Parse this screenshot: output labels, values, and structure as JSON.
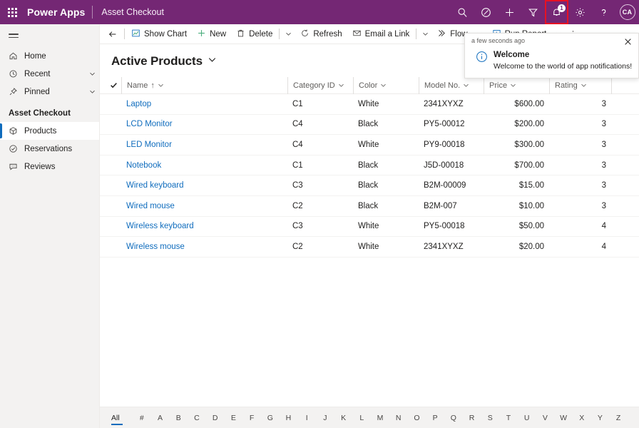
{
  "topbar": {
    "waffle_label": "app-launcher",
    "brand": "Power Apps",
    "app_name": "Asset Checkout",
    "icons": [
      {
        "name": "search-icon",
        "label": "Search"
      },
      {
        "name": "diagnostics-icon",
        "label": "Diagnostics"
      },
      {
        "name": "plus-icon",
        "label": "Quick create"
      },
      {
        "name": "filter-icon",
        "label": "Filter"
      },
      {
        "name": "bell-icon",
        "label": "Notifications"
      },
      {
        "name": "gear-icon",
        "label": "Settings"
      },
      {
        "name": "help-icon",
        "label": "Help"
      }
    ],
    "notification_badge": "1",
    "avatar_initials": "CA",
    "accent_color": "#742774",
    "highlight_color": "#e81123"
  },
  "sidebar": {
    "hamburger_label": "Site map",
    "items": [
      {
        "label": "Home",
        "icon": "home-icon",
        "chevron": false
      },
      {
        "label": "Recent",
        "icon": "clock-icon",
        "chevron": true
      },
      {
        "label": "Pinned",
        "icon": "pin-icon",
        "chevron": true
      }
    ],
    "group_title": "Asset Checkout",
    "group_items": [
      {
        "label": "Products",
        "icon": "box-icon",
        "selected": true
      },
      {
        "label": "Reservations",
        "icon": "check-circle-icon",
        "selected": false
      },
      {
        "label": "Reviews",
        "icon": "comment-icon",
        "selected": false
      }
    ]
  },
  "commandbar": {
    "back_label": "Back",
    "commands": [
      {
        "label": "Show Chart",
        "icon": "chart-icon",
        "caret": false
      },
      {
        "label": "New",
        "icon": "plus-icon",
        "caret": false
      },
      {
        "label": "Delete",
        "icon": "trash-icon",
        "caret": true
      },
      {
        "label": "Refresh",
        "icon": "refresh-icon",
        "caret": false
      },
      {
        "label": "Email a Link",
        "icon": "email-link-icon",
        "caret": true
      },
      {
        "label": "Flow",
        "icon": "flow-icon",
        "caret": true
      },
      {
        "label": "Run Report",
        "icon": "report-icon",
        "caret": true
      }
    ]
  },
  "view": {
    "title": "Active Products",
    "chevron": "chevron-down-icon"
  },
  "grid": {
    "columns": [
      {
        "label": "Name",
        "sort": "ascending",
        "sort_glyph": "↑"
      },
      {
        "label": "Category ID",
        "sort": null
      },
      {
        "label": "Color",
        "sort": null
      },
      {
        "label": "Model No.",
        "sort": null
      },
      {
        "label": "Price",
        "sort": null
      },
      {
        "label": "Rating",
        "sort": null
      }
    ],
    "rows": [
      {
        "name": "Laptop",
        "category": "C1",
        "color": "White",
        "model": "2341XYXZ",
        "price": "$600.00",
        "rating": "3"
      },
      {
        "name": "LCD Monitor",
        "category": "C4",
        "color": "Black",
        "model": "PY5-00012",
        "price": "$200.00",
        "rating": "3"
      },
      {
        "name": "LED Monitor",
        "category": "C4",
        "color": "White",
        "model": "PY9-00018",
        "price": "$300.00",
        "rating": "3"
      },
      {
        "name": "Notebook",
        "category": "C1",
        "color": "Black",
        "model": "J5D-00018",
        "price": "$700.00",
        "rating": "3"
      },
      {
        "name": "Wired keyboard",
        "category": "C3",
        "color": "Black",
        "model": "B2M-00009",
        "price": "$15.00",
        "rating": "3"
      },
      {
        "name": "Wired mouse",
        "category": "C2",
        "color": "Black",
        "model": "B2M-007",
        "price": "$10.00",
        "rating": "3"
      },
      {
        "name": "Wireless keyboard",
        "category": "C3",
        "color": "White",
        "model": "PY5-00018",
        "price": "$50.00",
        "rating": "4"
      },
      {
        "name": "Wireless mouse",
        "category": "C2",
        "color": "White",
        "model": "2341XYXZ",
        "price": "$20.00",
        "rating": "4"
      }
    ]
  },
  "alphabet": {
    "items": [
      "All",
      "#",
      "A",
      "B",
      "C",
      "D",
      "E",
      "F",
      "G",
      "H",
      "I",
      "J",
      "K",
      "L",
      "M",
      "N",
      "O",
      "P",
      "Q",
      "R",
      "S",
      "T",
      "U",
      "V",
      "W",
      "X",
      "Y",
      "Z"
    ],
    "active": "All"
  },
  "notification": {
    "time": "a few seconds ago",
    "title": "Welcome",
    "message": "Welcome to the world of app notifications!",
    "icon": "info-icon",
    "close": "close-icon"
  }
}
